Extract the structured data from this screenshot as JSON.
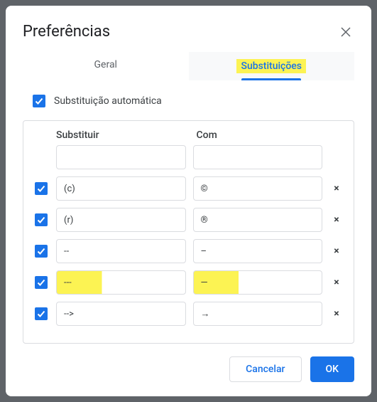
{
  "dialog": {
    "title": "Preferências",
    "tabs": {
      "general": "Geral",
      "substitutions": "Substituições"
    },
    "auto_substitution_label": "Substituição automática",
    "columns": {
      "replace": "Substituir",
      "with": "Com"
    },
    "rows": [
      {
        "enabled": false,
        "replace": "",
        "with": "",
        "deletable": false,
        "highlight": false
      },
      {
        "enabled": true,
        "replace": "(c)",
        "with": "©",
        "deletable": true,
        "highlight": false
      },
      {
        "enabled": true,
        "replace": "(r)",
        "with": "®",
        "deletable": true,
        "highlight": false
      },
      {
        "enabled": true,
        "replace": "--",
        "with": "–",
        "deletable": true,
        "highlight": false
      },
      {
        "enabled": true,
        "replace": "---",
        "with": "—",
        "deletable": true,
        "highlight": true
      },
      {
        "enabled": true,
        "replace": "-->",
        "with": "→",
        "deletable": true,
        "highlight": false
      }
    ],
    "buttons": {
      "cancel": "Cancelar",
      "ok": "OK"
    }
  }
}
